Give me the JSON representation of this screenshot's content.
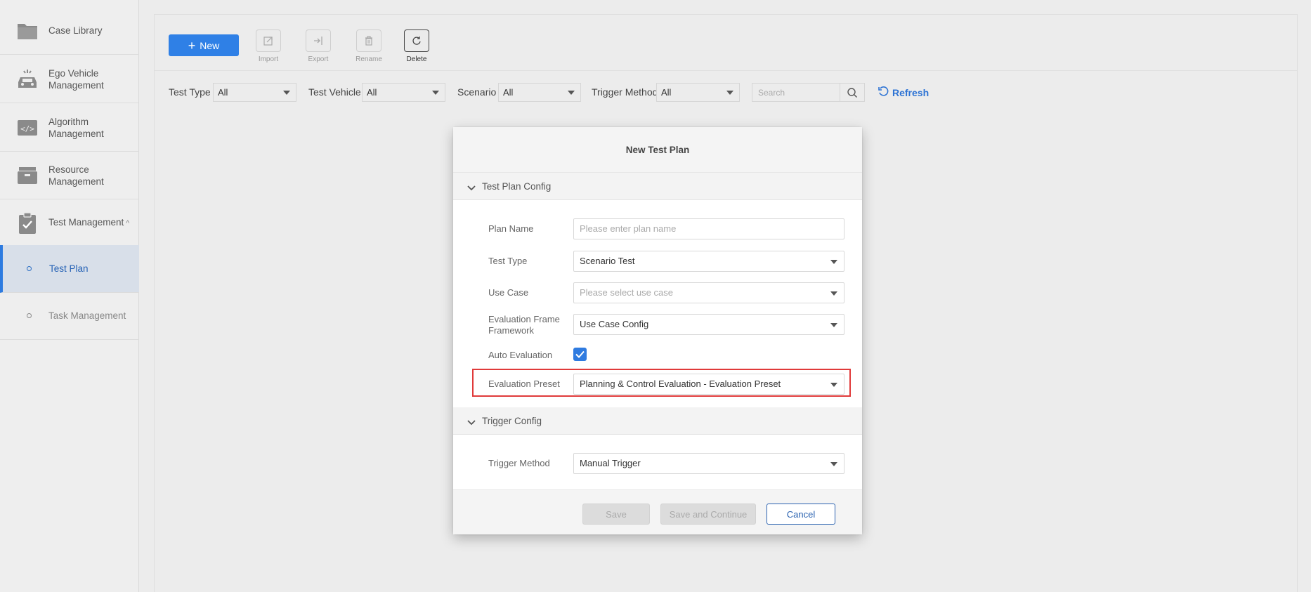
{
  "sidebar": {
    "items": [
      {
        "label": "Case Library",
        "icon": "folder-icon"
      },
      {
        "label": "Ego Vehicle Management",
        "icon": "car-icon"
      },
      {
        "label": "Algorithm Management",
        "icon": "code-icon"
      },
      {
        "label": "Resource Management",
        "icon": "archive-icon"
      },
      {
        "label": "Test Management",
        "icon": "clipboard-check-icon",
        "caret": "^"
      }
    ],
    "subitems": [
      {
        "label": "Test Plan",
        "active": true
      },
      {
        "label": "Task Management",
        "active": false
      }
    ]
  },
  "toolbar": {
    "new_label": "New",
    "new_icon": "+",
    "import_label": "Import",
    "export_label": "Export",
    "rename_label": "Rename",
    "delete_label": "Delete"
  },
  "filters": {
    "test_type_label": "Test Type",
    "test_type_value": "All",
    "test_vehicle_label": "Test Vehicle",
    "test_vehicle_value": "All",
    "scenario_label": "Scenario",
    "scenario_value": "All",
    "trigger_method_label": "Trigger Method",
    "trigger_method_value": "All",
    "search_placeholder": "Search",
    "refresh_label": "Refresh"
  },
  "modal": {
    "title": "New Test Plan",
    "section1_title": "Test Plan Config",
    "plan_name_label": "Plan Name",
    "plan_name_placeholder": "Please enter plan name",
    "test_type_label": "Test Type",
    "test_type_value": "Scenario Test",
    "use_case_label": "Use Case",
    "use_case_placeholder": "Please select use case",
    "eval_framework_label_1": "Evaluation Frame",
    "eval_framework_label_2": "Framework",
    "eval_framework_value": "Use Case Config",
    "auto_eval_label": "Auto Evaluation",
    "auto_eval_checked": true,
    "eval_preset_label": "Evaluation Preset",
    "eval_preset_value": "Planning & Control Evaluation - Evaluation Preset",
    "section2_title": "Trigger Config",
    "trigger_method_label": "Trigger Method",
    "trigger_method_value": "Manual Trigger",
    "save_label": "Save",
    "save_continue_label": "Save and Continue",
    "cancel_label": "Cancel"
  },
  "colors": {
    "accent": "#2f80e6",
    "highlight": "#e03a3a",
    "sidebar_active_bg": "#d8dfe9"
  }
}
